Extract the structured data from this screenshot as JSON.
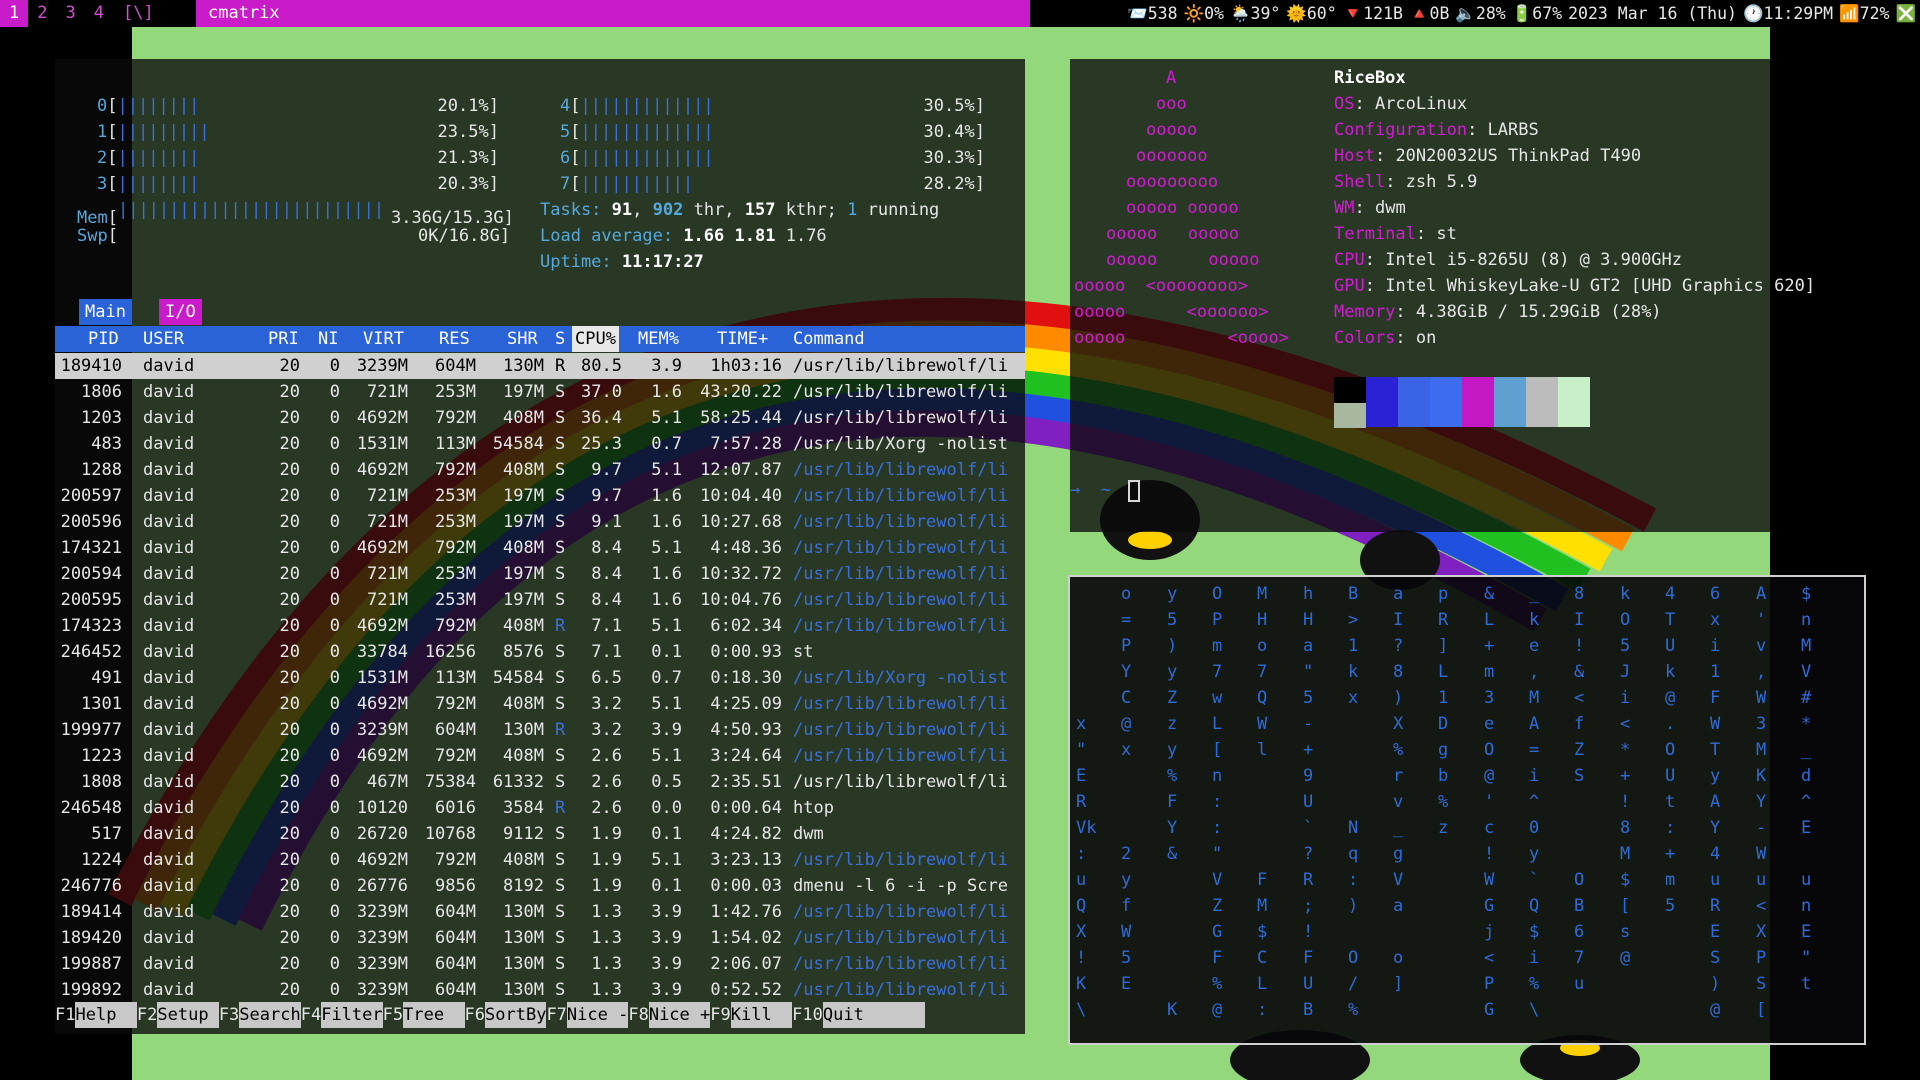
{
  "bar": {
    "tags": [
      "1",
      "2",
      "3",
      "4"
    ],
    "active_tag": "1",
    "layout": "[\\]",
    "window_title": "cmatrix",
    "status": [
      "📨538",
      "🔆0%",
      "🌦️39°",
      "🌞60°",
      "🔻121B",
      "🔺0B",
      "🔈28%",
      "🔋67%",
      "2023 Mar 16 (Thu)",
      "🕐11:29PM",
      "📶72%",
      "❎"
    ]
  },
  "htop": {
    "cpus": [
      {
        "id": "0",
        "bars": "||||||||",
        "pct": "20.1%"
      },
      {
        "id": "1",
        "bars": "|||||||||",
        "pct": "23.5%"
      },
      {
        "id": "2",
        "bars": "||||||||",
        "pct": "21.3%"
      },
      {
        "id": "3",
        "bars": "||||||||",
        "pct": "20.3%"
      },
      {
        "id": "4",
        "bars": "|||||||||||||",
        "pct": "30.5%"
      },
      {
        "id": "5",
        "bars": "|||||||||||||",
        "pct": "30.4%"
      },
      {
        "id": "6",
        "bars": "|||||||||||||",
        "pct": "30.3%"
      },
      {
        "id": "7",
        "bars": "|||||||||||",
        "pct": "28.2%"
      }
    ],
    "mem": {
      "label": "Mem",
      "bars": "||||||||||||||||||||||||||",
      "value": "3.36G/15.3G"
    },
    "swp": {
      "label": "Swp",
      "bars": "",
      "value": "0K/16.8G"
    },
    "tasks": {
      "label": "Tasks:",
      "tasks": "91",
      "sep1": ", ",
      "thr": "902",
      "thr_label": " thr, ",
      "kthr": "157",
      "kthr_label": " kthr; ",
      "running": "1",
      "running_label": " running"
    },
    "load": {
      "label": "Load average:",
      "one": "1.66",
      "five": "1.81",
      "fifteen": "1.76"
    },
    "uptime": {
      "label": "Uptime:",
      "value": "11:17:27"
    },
    "tabs": [
      "Main",
      "I/O"
    ],
    "columns": [
      "PID",
      "USER",
      "PRI",
      "NI",
      "VIRT",
      "RES",
      "SHR",
      "S",
      "CPU%",
      "MEM%",
      "TIME+",
      "Command"
    ],
    "processes": [
      [
        "189410",
        "david",
        "20",
        "0",
        "3239M",
        "604M",
        "130M",
        "R",
        "80.5",
        "3.9",
        "1h03:16",
        "/usr/lib/librewolf/li"
      ],
      [
        "1806",
        "david",
        "20",
        "0",
        "721M",
        "253M",
        "197M",
        "S",
        "37.0",
        "1.6",
        "43:20.22",
        "/usr/lib/librewolf/li"
      ],
      [
        "1203",
        "david",
        "20",
        "0",
        "4692M",
        "792M",
        "408M",
        "S",
        "36.4",
        "5.1",
        "58:25.44",
        "/usr/lib/librewolf/li"
      ],
      [
        "483",
        "david",
        "20",
        "0",
        "1531M",
        "113M",
        "54584",
        "S",
        "25.3",
        "0.7",
        "7:57.28",
        "/usr/lib/Xorg -nolist"
      ],
      [
        "1288",
        "david",
        "20",
        "0",
        "4692M",
        "792M",
        "408M",
        "S",
        "9.7",
        "5.1",
        "12:07.87",
        "/usr/lib/librewolf/li"
      ],
      [
        "200597",
        "david",
        "20",
        "0",
        "721M",
        "253M",
        "197M",
        "S",
        "9.7",
        "1.6",
        "10:04.40",
        "/usr/lib/librewolf/li"
      ],
      [
        "200596",
        "david",
        "20",
        "0",
        "721M",
        "253M",
        "197M",
        "S",
        "9.1",
        "1.6",
        "10:27.68",
        "/usr/lib/librewolf/li"
      ],
      [
        "174321",
        "david",
        "20",
        "0",
        "4692M",
        "792M",
        "408M",
        "S",
        "8.4",
        "5.1",
        "4:48.36",
        "/usr/lib/librewolf/li"
      ],
      [
        "200594",
        "david",
        "20",
        "0",
        "721M",
        "253M",
        "197M",
        "S",
        "8.4",
        "1.6",
        "10:32.72",
        "/usr/lib/librewolf/li"
      ],
      [
        "200595",
        "david",
        "20",
        "0",
        "721M",
        "253M",
        "197M",
        "S",
        "8.4",
        "1.6",
        "10:04.76",
        "/usr/lib/librewolf/li"
      ],
      [
        "174323",
        "david",
        "20",
        "0",
        "4692M",
        "792M",
        "408M",
        "R",
        "7.1",
        "5.1",
        "6:02.34",
        "/usr/lib/librewolf/li"
      ],
      [
        "246452",
        "david",
        "20",
        "0",
        "33784",
        "16256",
        "8576",
        "S",
        "7.1",
        "0.1",
        "0:00.93",
        "st"
      ],
      [
        "491",
        "david",
        "20",
        "0",
        "1531M",
        "113M",
        "54584",
        "S",
        "6.5",
        "0.7",
        "0:18.30",
        "/usr/lib/Xorg -nolist"
      ],
      [
        "1301",
        "david",
        "20",
        "0",
        "4692M",
        "792M",
        "408M",
        "S",
        "3.2",
        "5.1",
        "4:25.09",
        "/usr/lib/librewolf/li"
      ],
      [
        "199977",
        "david",
        "20",
        "0",
        "3239M",
        "604M",
        "130M",
        "R",
        "3.2",
        "3.9",
        "4:50.93",
        "/usr/lib/librewolf/li"
      ],
      [
        "1223",
        "david",
        "20",
        "0",
        "4692M",
        "792M",
        "408M",
        "S",
        "2.6",
        "5.1",
        "3:24.64",
        "/usr/lib/librewolf/li"
      ],
      [
        "1808",
        "david",
        "20",
        "0",
        "467M",
        "75384",
        "61332",
        "S",
        "2.6",
        "0.5",
        "2:35.51",
        "/usr/lib/librewolf/li"
      ],
      [
        "246548",
        "david",
        "20",
        "0",
        "10120",
        "6016",
        "3584",
        "R",
        "2.6",
        "0.0",
        "0:00.64",
        "htop"
      ],
      [
        "517",
        "david",
        "20",
        "0",
        "26720",
        "10768",
        "9112",
        "S",
        "1.9",
        "0.1",
        "4:24.82",
        "dwm"
      ],
      [
        "1224",
        "david",
        "20",
        "0",
        "4692M",
        "792M",
        "408M",
        "S",
        "1.9",
        "5.1",
        "3:23.13",
        "/usr/lib/librewolf/li"
      ],
      [
        "246776",
        "david",
        "20",
        "0",
        "26776",
        "9856",
        "8192",
        "S",
        "1.9",
        "0.1",
        "0:00.03",
        "dmenu -l 6 -i -p Scre"
      ],
      [
        "189414",
        "david",
        "20",
        "0",
        "3239M",
        "604M",
        "130M",
        "S",
        "1.3",
        "3.9",
        "1:42.76",
        "/usr/lib/librewolf/li"
      ],
      [
        "189420",
        "david",
        "20",
        "0",
        "3239M",
        "604M",
        "130M",
        "S",
        "1.3",
        "3.9",
        "1:54.02",
        "/usr/lib/librewolf/li"
      ],
      [
        "199887",
        "david",
        "20",
        "0",
        "3239M",
        "604M",
        "130M",
        "S",
        "1.3",
        "3.9",
        "2:06.07",
        "/usr/lib/librewolf/li"
      ],
      [
        "199892",
        "david",
        "20",
        "0",
        "3239M",
        "604M",
        "130M",
        "S",
        "1.3",
        "3.9",
        "0:52.52",
        "/usr/lib/librewolf/li"
      ]
    ],
    "fkeys": [
      {
        "key": "F1",
        "label": "Help  "
      },
      {
        "key": "F2",
        "label": "Setup "
      },
      {
        "key": "F3",
        "label": "Search"
      },
      {
        "key": "F4",
        "label": "Filter"
      },
      {
        "key": "F5",
        "label": "Tree  "
      },
      {
        "key": "F6",
        "label": "SortBy"
      },
      {
        "key": "F7",
        "label": "Nice -"
      },
      {
        "key": "F8",
        "label": "Nice +"
      },
      {
        "key": "F9",
        "label": "Kill  "
      },
      {
        "key": "F10",
        "label": "Quit      "
      }
    ]
  },
  "neofetch": {
    "logo": [
      "A",
      "ooo",
      "ooooo",
      "ooooooo",
      "ooooooooo",
      "ooooo ooooo",
      "ooooo   ooooo",
      "ooooo     ooooo",
      "ooooo  <oooooooo>",
      "ooooo      <oooooo>",
      "ooooo          <oooo>"
    ],
    "hostname": "RiceBox",
    "info": [
      {
        "key": "OS",
        "value": "ArcoLinux"
      },
      {
        "key": "Configuration",
        "value": "LARBS"
      },
      {
        "key": "Host",
        "value": "20N20032US ThinkPad T490"
      },
      {
        "key": "Shell",
        "value": "zsh 5.9"
      },
      {
        "key": "WM",
        "value": "dwm"
      },
      {
        "key": "Terminal",
        "value": "st"
      },
      {
        "key": "CPU",
        "value": "Intel i5-8265U (8) @ 3.900GHz"
      },
      {
        "key": "GPU",
        "value": "Intel WhiskeyLake-U GT2 [UHD Graphics 620]"
      },
      {
        "key": "Memory",
        "value": "4.38GiB / 15.29GiB (28%)"
      },
      {
        "key": "Colors",
        "value": "on"
      }
    ],
    "palette_top": [
      "#000000",
      "#2b22d6",
      "#3a63e6",
      "#3d6cf0",
      "#c518c5",
      "#5fa0d0",
      "#bcbcbc",
      "#c8f0c8"
    ],
    "palette_bottom": [
      "#a8b8a0"
    ],
    "prompt": "→  ~ "
  },
  "cmatrix": {
    "columns": [
      " \n \n \n \n \nx\n\"\nE\nR\nVk\n:\nu\nQ\nX\n!\nK\n\\",
      "o\n=\nP\nY\nC\n@\nx\n \n \n \n2\ny\nf\nW\n5\nE\n ",
      "y\n5\n)\ny\nZ\nz\ny\n%\nF\nY\n&\n \n \n \n \n \nK",
      "O\nP\nm\n7\nw\nL\n[\nn\n:\n:\n\"\nV\nZ\nG\nF\n%\n@",
      "M\nH\no\n7\nQ\nW\nl\n \n \n \n \nF\nM\n$\nC\nL\n:",
      "h\nH\na\n\"\n5\n-\n+\n9\nU\n`\n?\nR\n;\n!\nF\nU\nB",
      "B\n>\n1\nk\nx\n \n \n \n \nN\nq\n:\n)\n \nO\n/\n%",
      "a\nI\n?\n8\n)\nX\n%\nr\nv\n_\ng\nV\na\n \no\n]\n ",
      "p\nR\n]\nL\n1\nD\ng\nb\n%\nz\n \n \n \n \n \n \n ",
      "&\nL\n+\nm\n3\ne\nO\n@\n'\nc\n!\nW\nG\nj\n<\nP\nG",
      "_\nk\ne\n,\nM\nA\n=\ni\n^\n0\ny\n`\nQ\n$\ni\n%\n\\",
      "8\nI\n!\n&\n<\nf\nZ\nS\n \n \n \nO\nB\n6\n7\nu\n ",
      "k\nO\n5\nJ\ni\n<\n*\n+\n!\n8\nM\n$\n[\ns\n@\n \n ",
      "4\nT\nU\nk\n@\n.\nO\nU\nt\n:\n+\nm\n5\n \n \n \n ",
      "6\nx\ni\n1\nF\nW\nT\ny\nA\nY\n4\nu\nR\nE\nS\n)\n@",
      "A\n'\nv\n,\nW\n3\nM\nK\nY\n-\nW\nu\n<\nX\nP\nS\n[",
      "$\nn\nM\nV\n#\n*\n_\nd\n^\nE\n \nu\nn\nE\n\"\nt\n "
    ]
  }
}
